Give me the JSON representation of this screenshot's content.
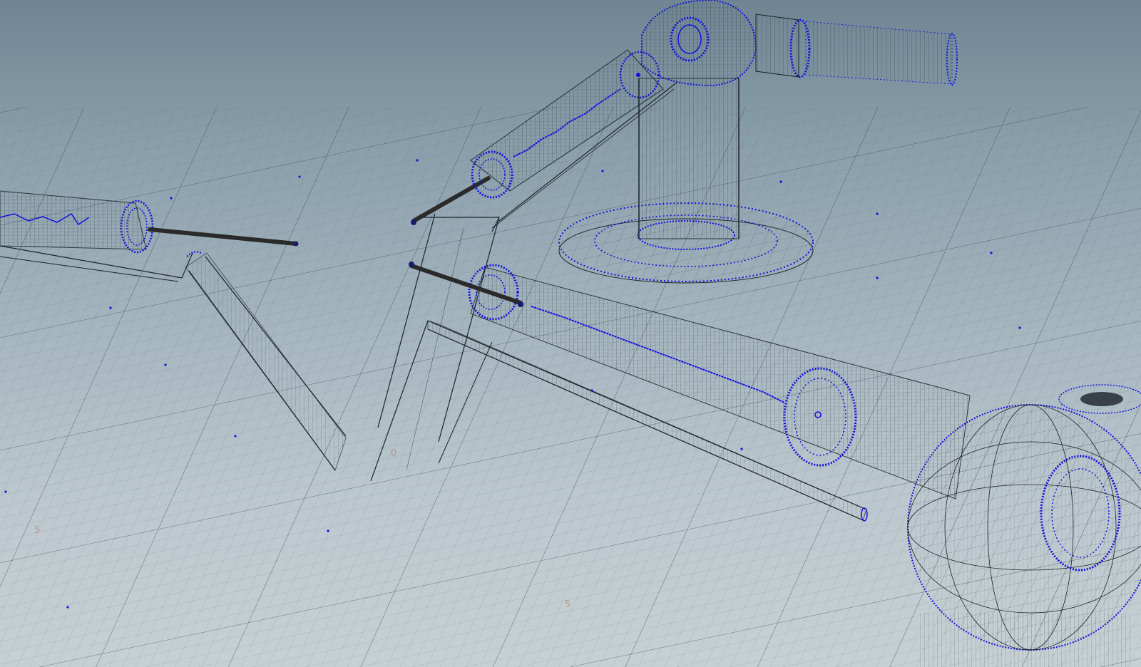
{
  "viewport": {
    "type": "3d-wireframe-viewport",
    "background_top": "#6f8593",
    "background_bottom": "#c6d0d4",
    "grid_color": "#3c4a55",
    "vertex_color": "#1010e0",
    "edge_color": "#1c2228"
  },
  "grid_labels": [
    "5",
    "5",
    "0"
  ],
  "objects": [
    {
      "name": "left-cylinder-arm",
      "kind": "cylinder"
    },
    {
      "name": "left-bent-bar",
      "kind": "bar"
    },
    {
      "name": "center-bent-bar",
      "kind": "bar"
    },
    {
      "name": "upper-diagonal-cylinder",
      "kind": "cylinder"
    },
    {
      "name": "robot-base-post",
      "kind": "cylinder"
    },
    {
      "name": "robot-base-disc",
      "kind": "disc"
    },
    {
      "name": "robot-elbow-joint",
      "kind": "sphere"
    },
    {
      "name": "robot-forearm-tube",
      "kind": "cylinder"
    },
    {
      "name": "lower-long-cylinder",
      "kind": "cylinder"
    },
    {
      "name": "lower-bar",
      "kind": "bar"
    },
    {
      "name": "large-sphere",
      "kind": "sphere"
    }
  ]
}
